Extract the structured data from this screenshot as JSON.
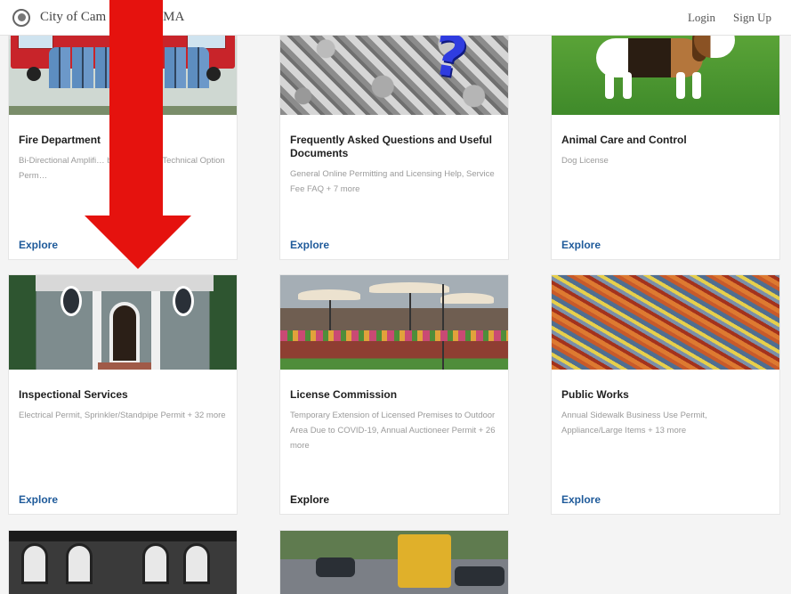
{
  "header": {
    "site_title": "City of Cam",
    "site_title_tail": "MA",
    "nav": [
      "Login",
      "Sign Up"
    ]
  },
  "cards": [
    {
      "title": "Fire Department",
      "desc": "Bi-Directional Amplifi… bon Monoxide Technical Option Perm…",
      "link": "Explore"
    },
    {
      "title": "Frequently Asked Questions and Useful Documents",
      "desc": "General Online Permitting and Licensing Help, Service Fee FAQ + 7 more",
      "link": "Explore"
    },
    {
      "title": "Animal Care and Control",
      "desc": "Dog License",
      "link": "Explore"
    },
    {
      "title": "Inspectional Services",
      "desc": "Electrical Permit, Sprinkler/Standpipe Permit + 32 more",
      "link": "Explore"
    },
    {
      "title": "License Commission",
      "desc": "Temporary Extension of Licensed Premises to Outdoor Area Due to COVID-19, Annual Auctioneer Permit + 26 more",
      "link": "Explore"
    },
    {
      "title": "Public Works",
      "desc": "Annual Sidewalk Business Use Permit, Appliance/Large Items + 13 more",
      "link": "Explore"
    }
  ],
  "colors": {
    "link": "#1e5a9a",
    "arrow": "#e5120e"
  }
}
